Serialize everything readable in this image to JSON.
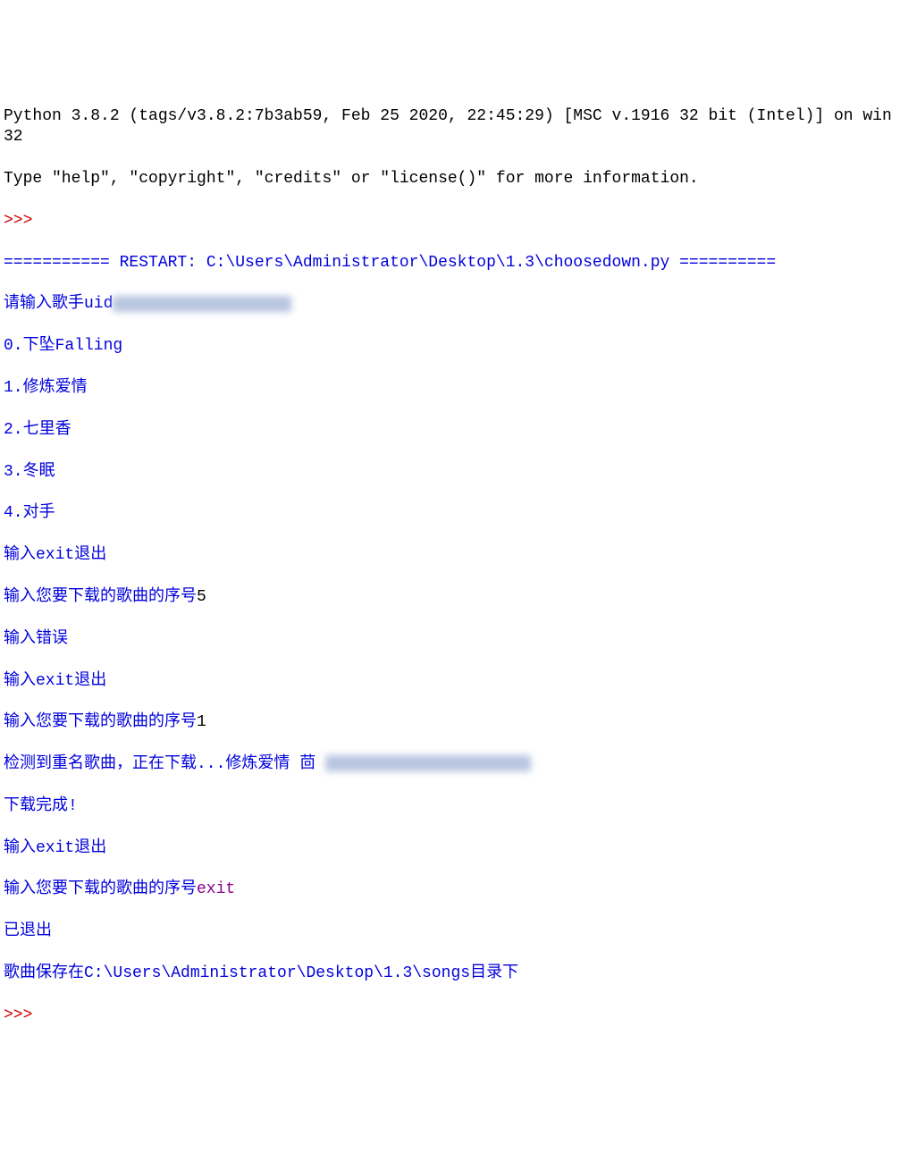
{
  "header": {
    "line1": "Python 3.8.2 (tags/v3.8.2:7b3ab59, Feb 25 2020, 22:45:29) [MSC v.1916 32 bit (Intel)] on win32",
    "line2": "Type \"help\", \"copyright\", \"credits\" or \"license()\" for more information."
  },
  "prompt1": ">>>",
  "restart": "=========== RESTART: C:\\Users\\Administrator\\Desktop\\1.3\\choosedown.py ==========",
  "output": {
    "uid_prompt": "请输入歌手uid",
    "songs": [
      "0.下坠Falling",
      "1.修炼爱情",
      "2.七里香",
      "3.冬眠",
      "4.对手"
    ],
    "exit_hint": "输入exit退出",
    "download_prompt": "输入您要下载的歌曲的序号",
    "input1": "5",
    "error": "输入错误",
    "input2": "1",
    "dup_detect": "检测到重名歌曲，正在下载...修炼爱情 茴 ",
    "done": "下载完成!",
    "input3": "exit",
    "exited": "已退出",
    "save_path": "歌曲保存在C:\\Users\\Administrator\\Desktop\\1.3\\songs目录下"
  },
  "prompt2": ">>> "
}
